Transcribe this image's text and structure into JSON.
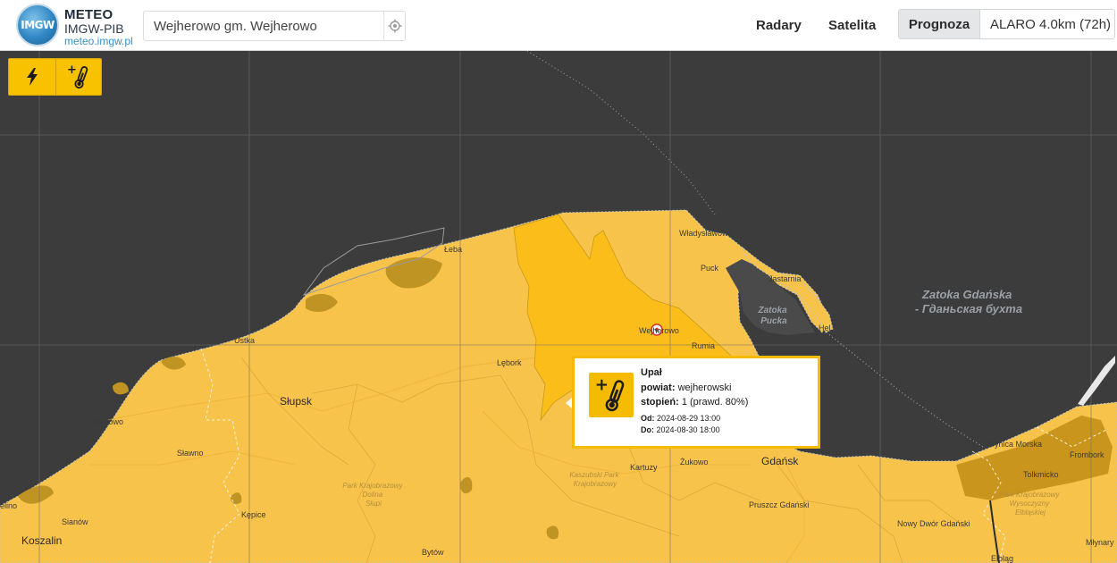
{
  "header": {
    "logo_text": "IMGW",
    "brand_line1": "METEO",
    "brand_line2": "IMGW-PIB",
    "brand_line3": "meteo.imgw.pl",
    "search_value": "Wejherowo gm. Wejherowo",
    "nav": {
      "radary": "Radary",
      "satelita": "Satelita",
      "prognoza": "Prognoza"
    },
    "model": "ALARO 4.0km (72h)"
  },
  "warning_types": [
    {
      "icon": "lightning-icon"
    },
    {
      "icon": "heat-thermometer-icon"
    }
  ],
  "map": {
    "colors": {
      "sea": "#3c3c3c",
      "land_warning": "#f8c34b",
      "warning_level1_powiat": "#fbbd1a",
      "dark_patch": "#c9951c",
      "grid": "#6e6e6e"
    },
    "places": [
      {
        "name": "Łeba"
      },
      {
        "name": "Władysławowo"
      },
      {
        "name": "Puck"
      },
      {
        "name": "Jastarnia"
      },
      {
        "name": "Hel"
      },
      {
        "name": "Wejherowo"
      },
      {
        "name": "Rumia"
      },
      {
        "name": "Ustka"
      },
      {
        "name": "Lębork"
      },
      {
        "name": "Słupsk"
      },
      {
        "name": "Darłowo"
      },
      {
        "name": "Sławno"
      },
      {
        "name": "Sianów"
      },
      {
        "name": "Koszalin"
      },
      {
        "name": "Kępice"
      },
      {
        "name": "Bytów"
      },
      {
        "name": "Kartuzy"
      },
      {
        "name": "Żukowo"
      },
      {
        "name": "Gdańsk"
      },
      {
        "name": "Pruszcz Gdański"
      },
      {
        "name": "Nowy Dwór Gdański"
      },
      {
        "name": "Krynica Morska"
      },
      {
        "name": "Tolkmicko"
      },
      {
        "name": "Frombork"
      },
      {
        "name": "Młynary"
      },
      {
        "name": "Elbląg"
      },
      {
        "name": "elino"
      }
    ],
    "sea_labels": [
      {
        "name": "Zatoka Gdańska - Гданьская бухта"
      },
      {
        "name": "Zatoka Pucka"
      }
    ],
    "park_labels": [
      {
        "name": "Park Krajobrazowy Dolina Słupi"
      },
      {
        "name": "Kaszubski Park Krajobrazowy"
      },
      {
        "name": "Park Krajobrazowy Wysoczyzny Elbląskiej"
      }
    ]
  },
  "popup": {
    "title": "Upał",
    "powiat_label": "powiat:",
    "powiat_value": "wejherowski",
    "stopien_label": "stopień:",
    "stopien_value": "1 (prawd. 80%)",
    "od_label": "Od:",
    "od_value": "2024-08-29 13:00",
    "do_label": "Do:",
    "do_value": "2024-08-30 18:00",
    "icon": "heat-thermometer-icon"
  }
}
